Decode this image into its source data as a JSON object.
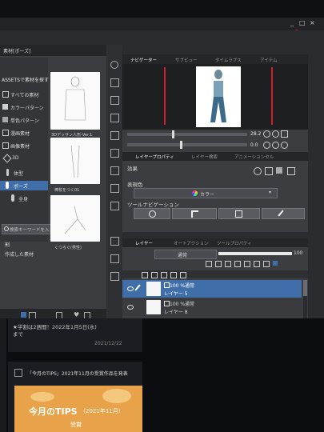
{
  "window": {
    "controls": [
      "_",
      "□",
      "×"
    ]
  },
  "materials": {
    "tab": "素材[ポーズ]",
    "assets_link": "ASSETSで素材を探す",
    "categories": [
      {
        "label": "すべての素材",
        "icon": "folder-icon"
      },
      {
        "label": "カラーパターン",
        "icon": "color-pattern-icon"
      },
      {
        "label": "単色パターン",
        "icon": "mono-pattern-icon"
      },
      {
        "label": "漫画素材",
        "icon": "manga-icon"
      },
      {
        "label": "画像素材",
        "icon": "image-icon"
      },
      {
        "label": "3D",
        "icon": "cube-icon"
      },
      {
        "label": "体型",
        "icon": "body-icon"
      },
      {
        "label": "ポーズ",
        "icon": "pose-icon"
      },
      {
        "label": "全身",
        "icon": "figure-icon"
      }
    ],
    "selected_index": 7,
    "search_placeholder": "検索キーワードを入",
    "bottom_items": [
      "割",
      "作成した素材"
    ],
    "thumbnails": [
      {
        "label": "3Dデッサン人形-Ver.1"
      },
      {
        "label": "棒杖をつく01"
      },
      {
        "label": "くつろぐ(男性)"
      }
    ]
  },
  "navigator": {
    "tabs": [
      "ナビゲーター",
      "サブビュー",
      "タイムラプス",
      "アイテム"
    ],
    "zoom_value": "28.2",
    "rotation_value": "0.0"
  },
  "layer_property": {
    "tabs": [
      "レイヤープロパティ",
      "レイヤー検索",
      "アニメーションセル"
    ],
    "effect_label": "効果",
    "color_label": "表現色",
    "color_value": "カラー",
    "tool_nav_label": "ツールナビゲーション"
  },
  "layers": {
    "tabs": [
      "レイヤー",
      "オートアクション",
      "ツールプロパティ"
    ],
    "blend_mode": "通常",
    "opacity": "100",
    "items": [
      {
        "title": "100 %通常",
        "name": "レイヤー 5",
        "selected": true
      },
      {
        "title": "100 %通常",
        "name": "レイヤー 8",
        "selected": false
      }
    ]
  },
  "web": {
    "notice_line1": "★学割は2週間！2022年1月5日(水)",
    "notice_line2": "まで",
    "notice_date": "2021/12/22",
    "tips_title": "「今月のTIPS」2021年11月の受賞作品を発表",
    "banner_title": "今月のTIPS",
    "banner_sub": "（2021年11月）",
    "banner_sub2": "受賞"
  },
  "colors": {
    "accent_blue": "#3f6ea8",
    "arrow_red": "#e01010",
    "nav_red_line": "#d0202a"
  }
}
